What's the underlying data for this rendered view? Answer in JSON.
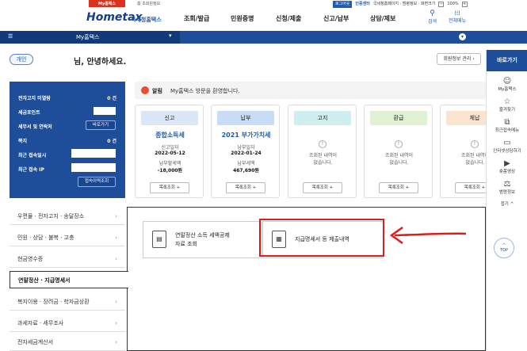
{
  "topbar": {
    "my_label": "My홈택스",
    "home_label": "홈 초회원정보",
    "login": "로그아웃",
    "cert": "인증센터",
    "links": "국세청홈페이지 · 범령정보 · 화면크기",
    "zoom": "100%"
  },
  "header": {
    "logo": "Hometax",
    "logo_sub": "국세청홈택스",
    "gnb": [
      "조회/발급",
      "민원증명",
      "신청/제출",
      "신고/납부",
      "상담/제보"
    ],
    "search_label": "검색",
    "allmenu_label": "전체메뉴"
  },
  "nav": {
    "current": "My홈택스"
  },
  "greeting": {
    "badge": "개인",
    "suffix": "님, 안녕하세요.",
    "member_button": "회원정보 관리 ›"
  },
  "quick": {
    "head": "바로가기",
    "items": [
      "My홈택스",
      "즐겨찾기",
      "최근접속메뉴",
      "인터넷상담하기",
      "숏폼영상",
      "범령정보",
      "접기 ^"
    ],
    "top": "TOP"
  },
  "info": {
    "unread_label": "전자고지 미열람",
    "unread_value": "0 건",
    "point_label": "세금포인트",
    "agent_label": "세무서 및 연락처",
    "agent_button": "바로가기",
    "note_label": "쪽지",
    "note_value": "0 건",
    "recent_label": "최근 접속일시",
    "ip_label": "최근 접속 IP",
    "history_button": "접속이력조회"
  },
  "notice": {
    "tag": "알림",
    "message": "My홈택스 방문을 환영합니다."
  },
  "cards": [
    {
      "head": "신고",
      "color": "#dbe7f7",
      "title": "종합소득세",
      "l1": "신고일자",
      "v1": "2022-05-12",
      "l2": "납부할세액",
      "v2": "-18,000원",
      "button": "목록조회 +"
    },
    {
      "head": "납부",
      "color": "#c8dcf5",
      "title": "2021 부가가치세",
      "l1": "납부일자",
      "v1": "2022-01-24",
      "l2": "납부세액",
      "v2": "467,690원",
      "button": "목록조회 +"
    },
    {
      "head": "고지",
      "color": "#cfeef0",
      "empty": "조회된 내역이\n없습니다.",
      "button": "목록조회 +"
    },
    {
      "head": "환급",
      "color": "#dff1d2",
      "empty": "조회된 내역이\n없습니다.",
      "button": "목록조회 +"
    },
    {
      "head": "체납",
      "color": "#fbe4cf",
      "empty": "조회된 내역이\n없습니다.",
      "button": "목록조회 +"
    }
  ],
  "leftmenu": [
    "우편물 · 전자고지 · 송달장소",
    "민원 · 상담 · 불복 · 고충",
    "현금영수증",
    "연말정산 · 지급명세서",
    "복지이용 · 장려금 · 학자금상환",
    "과세자료 · 세무조사",
    "전자세금계산서"
  ],
  "services": [
    {
      "title": "연말정산 소득 세액공제\n자료 조회"
    },
    {
      "title": "지급명세서 등 제출내역"
    }
  ]
}
